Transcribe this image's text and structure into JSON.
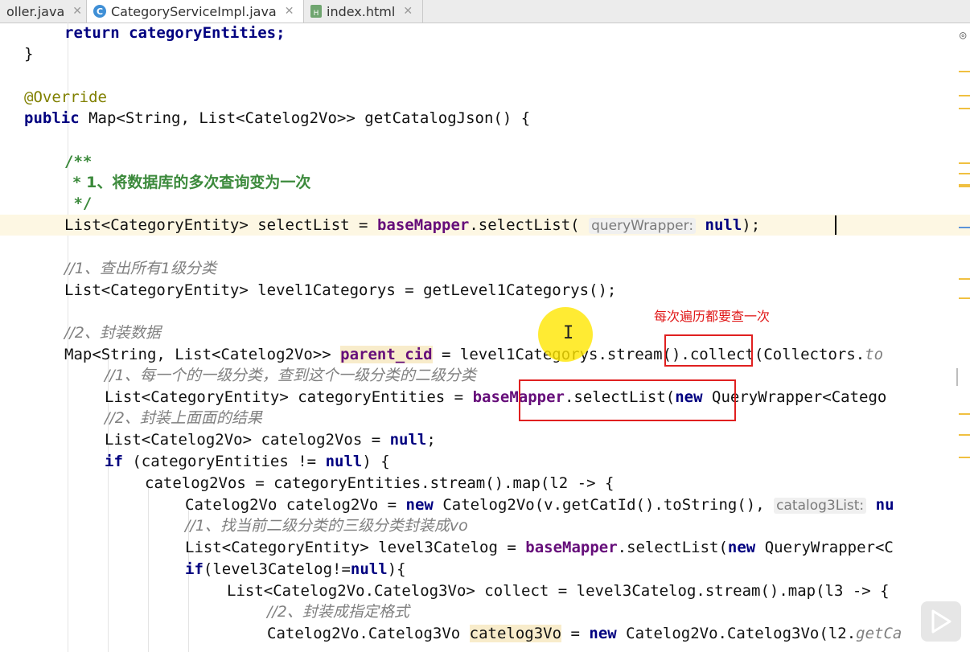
{
  "tabs": [
    {
      "label": "oller.java",
      "icon": "java-file-icon",
      "active": false
    },
    {
      "label": "CategoryServiceImpl.java",
      "icon": "class-c-icon",
      "active": true
    },
    {
      "label": "index.html",
      "icon": "html-file-icon",
      "active": false
    }
  ],
  "close_glyph": "✕",
  "code": {
    "l1": "return categoryEntities;",
    "l2": "}",
    "l3": "@Override",
    "l4a": "public",
    "l4b": " Map<String, List<Catelog2Vo>> getCatalogJson() {",
    "l5": "/**",
    "l6": " * 1、将数据库的多次查询变为一次",
    "l7": " */",
    "l8a": "List<CategoryEntity> selectList = ",
    "l8b": "baseMapper",
    "l8c": ".selectList(",
    "l8hint": "queryWrapper:",
    "l8d": "null",
    "l8e": ");",
    "l9": "//1、查出所有1级分类",
    "l10": "List<CategoryEntity> level1Categorys = getLevel1Categorys();",
    "l11": "//2、封装数据",
    "l12a": "Map<String, List<Catelog2Vo>> ",
    "l12b": "parent_cid",
    "l12c": " = level1Categorys.stream().collect(Collectors.",
    "l12d": "to",
    "l13": "//1、每一个的一级分类，查到这个一级分类的二级分类",
    "l14a": "List<CategoryEntity> categoryEntities = ",
    "l14b": "baseMapper",
    "l14c": ".selectList(",
    "l14d": "new",
    "l14e": " QueryWrapper<Catego",
    "l15": "//2、封装上面面的结果",
    "l16a": "List<Catelog2Vo> catelog2Vos = ",
    "l16b": "null",
    "l16c": ";",
    "l17a": "if",
    "l17b": " (categoryEntities != ",
    "l17c": "null",
    "l17d": ") {",
    "l18": "catelog2Vos = categoryEntities.stream().map(l2 -> {",
    "l19a": "Catelog2Vo catelog2Vo = ",
    "l19b": "new",
    "l19c": " Catelog2Vo(v.getCatId().toString(),",
    "l19hint": "catalog3List:",
    "l19d": "nu",
    "l20": "//1、找当前二级分类的三级分类封装成vo",
    "l21a": "List<CategoryEntity> level3Catelog = ",
    "l21b": "baseMapper",
    "l21c": ".selectList(",
    "l21d": "new",
    "l21e": " QueryWrapper<C",
    "l22a": "if",
    "l22b": "(level3Catelog!=",
    "l22c": "null",
    "l22d": "){",
    "l23": "List<Catelog2Vo.Catelog3Vo> collect = level3Catelog.stream().map(l3 -> {",
    "l24": "//2、封装成指定格式",
    "l25a": "Catelog2Vo.Catelog3Vo ",
    "l25b": "catelog3Vo",
    "l25c": " = ",
    "l25d": "new",
    "l25e": " Catelog2Vo.Catelog3Vo(l2.",
    "l25f": "getCa"
  },
  "annotation_note": "每次遍历都要查一次",
  "colors": {
    "keyword": "#000080",
    "annotation": "#808000",
    "comment": "#808080",
    "doc_comment": "#3c8a3c",
    "field": "#660e7a",
    "red_annotation": "#e01818",
    "cursor_highlight": "#ffe600"
  }
}
